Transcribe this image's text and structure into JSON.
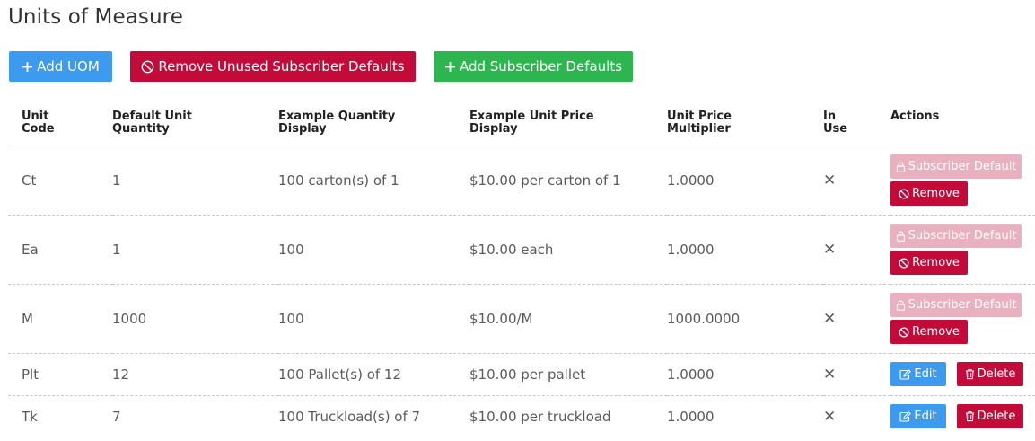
{
  "page": {
    "title": "Units of Measure"
  },
  "toolbar": {
    "add_uom": "Add UOM",
    "remove_unused": "Remove Unused Subscriber Defaults",
    "add_defaults": "Add Subscriber Defaults"
  },
  "table": {
    "headers": {
      "unit_code_1": "Unit",
      "unit_code_2": "Code",
      "default_qty_1": "Default Unit",
      "default_qty_2": "Quantity",
      "example_qty_1": "Example Quantity",
      "example_qty_2": "Display",
      "example_price_1": "Example Unit Price",
      "example_price_2": "Display",
      "multiplier_1": "Unit Price",
      "multiplier_2": "Multiplier",
      "in_use_1": "In",
      "in_use_2": "Use",
      "actions": "Actions"
    },
    "rows": [
      {
        "code": "Ct",
        "qty": "1",
        "qty_display": "100 carton(s) of 1",
        "price_display": "$10.00 per carton of 1",
        "multiplier": "1.0000",
        "in_use": "✕"
      },
      {
        "code": "Ea",
        "qty": "1",
        "qty_display": "100",
        "price_display": "$10.00 each",
        "multiplier": "1.0000",
        "in_use": "✕"
      },
      {
        "code": "M",
        "qty": "1000",
        "qty_display": "100",
        "price_display": "$10.00/M",
        "multiplier": "1000.0000",
        "in_use": "✕"
      },
      {
        "code": "Plt",
        "qty": "12",
        "qty_display": "100 Pallet(s) of 12",
        "price_display": "$10.00 per pallet",
        "multiplier": "1.0000",
        "in_use": "✕"
      },
      {
        "code": "Tk",
        "qty": "7",
        "qty_display": "100 Truckload(s) of 7",
        "price_display": "$10.00 per truckload",
        "multiplier": "1.0000",
        "in_use": "✕"
      }
    ]
  },
  "actions": {
    "subscriber_default": "Subscriber Default",
    "remove": "Remove",
    "edit": "Edit",
    "delete": "Delete"
  },
  "colors": {
    "primary": "#3c9aef",
    "danger": "#c30b3a",
    "success": "#2db64f",
    "disabled_danger": "#e9b1bf"
  }
}
